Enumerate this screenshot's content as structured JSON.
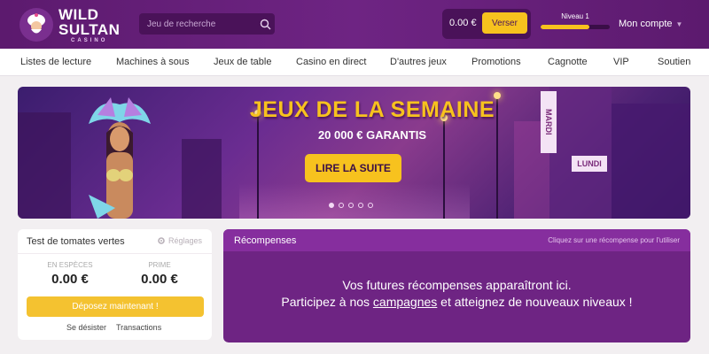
{
  "header": {
    "logo": {
      "line1": "WILD",
      "line2": "SULTAN",
      "line3": "CASINO"
    },
    "search": {
      "placeholder": "Jeu de recherche"
    },
    "balance": "0.00 €",
    "deposit_label": "Verser",
    "level": {
      "label": "Niveau 1",
      "progress": 0.7
    },
    "account_label": "Mon compte"
  },
  "nav": {
    "items": [
      "Listes de lecture",
      "Machines à sous",
      "Jeux de table",
      "Casino en direct",
      "D'autres jeux",
      "Promotions",
      "Cagnotte",
      "VIP",
      "Soutien"
    ]
  },
  "banner": {
    "headline": "JEUX DE LA SEMAINE",
    "subline": "20 000 € GARANTIS",
    "cta": "LIRE LA SUITE",
    "dots_count": 5,
    "active_dot": 0,
    "signs": [
      "MARDI",
      "LUNDI"
    ]
  },
  "wallet_card": {
    "title": "Test de tomates vertes",
    "settings": "Réglages",
    "cash_label": "EN ESPÈCES",
    "cash_value": "0.00 €",
    "bonus_label": "PRIME",
    "bonus_value": "0.00 €",
    "deposit_cta": "Déposez maintenant !",
    "withdraw_label": "Se désister",
    "transactions_label": "Transactions"
  },
  "rewards": {
    "title": "Récompenses",
    "hint": "Cliquez sur une récompense pour l'utiliser",
    "line1": "Vos futures récompenses apparaîtront ici.",
    "line2_pre": "Participez à nos ",
    "line2_link": "campagnes",
    "line2_post": " et atteignez de nouveaux niveaux !"
  },
  "colors": {
    "header_purple": "#6e2483",
    "accent_yellow": "#f7c21e",
    "rewards_purple": "#6e2483"
  }
}
